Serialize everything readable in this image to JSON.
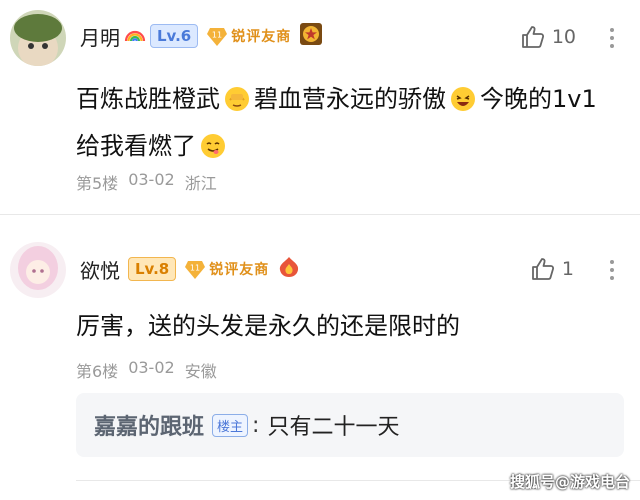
{
  "comments": [
    {
      "username": "月明",
      "name_emoji_icon": "rainbow-icon",
      "level": "Lv.6",
      "badge_number": "11",
      "badge_label": "锐评友商",
      "medal_icon": "gold-medal-icon",
      "like_count": "10",
      "content_part1": "百炼战胜橙武",
      "content_part2": "碧血营永远的骄傲",
      "content_part3": "今晚的1v1给我看燃了",
      "floor": "第5楼",
      "date": "03-02",
      "location": "浙江"
    },
    {
      "username": "欲悦",
      "level": "Lv.8",
      "badge_number": "11",
      "badge_label": "锐评友商",
      "medal_icon": "flame-icon",
      "like_count": "1",
      "content": "厉害，送的头发是永久的还是限时的",
      "floor": "第6楼",
      "date": "03-02",
      "location": "安徽",
      "reply": {
        "username": "嘉嘉的跟班",
        "tag": "楼主",
        "separator": ":",
        "text": "只有二十一天"
      }
    }
  ],
  "watermark": "搜狐号@游戏电台",
  "colors": {
    "level_blue": "#4a7ad9",
    "level_orange": "#d97f00",
    "badge_gold": "#e0901a"
  }
}
